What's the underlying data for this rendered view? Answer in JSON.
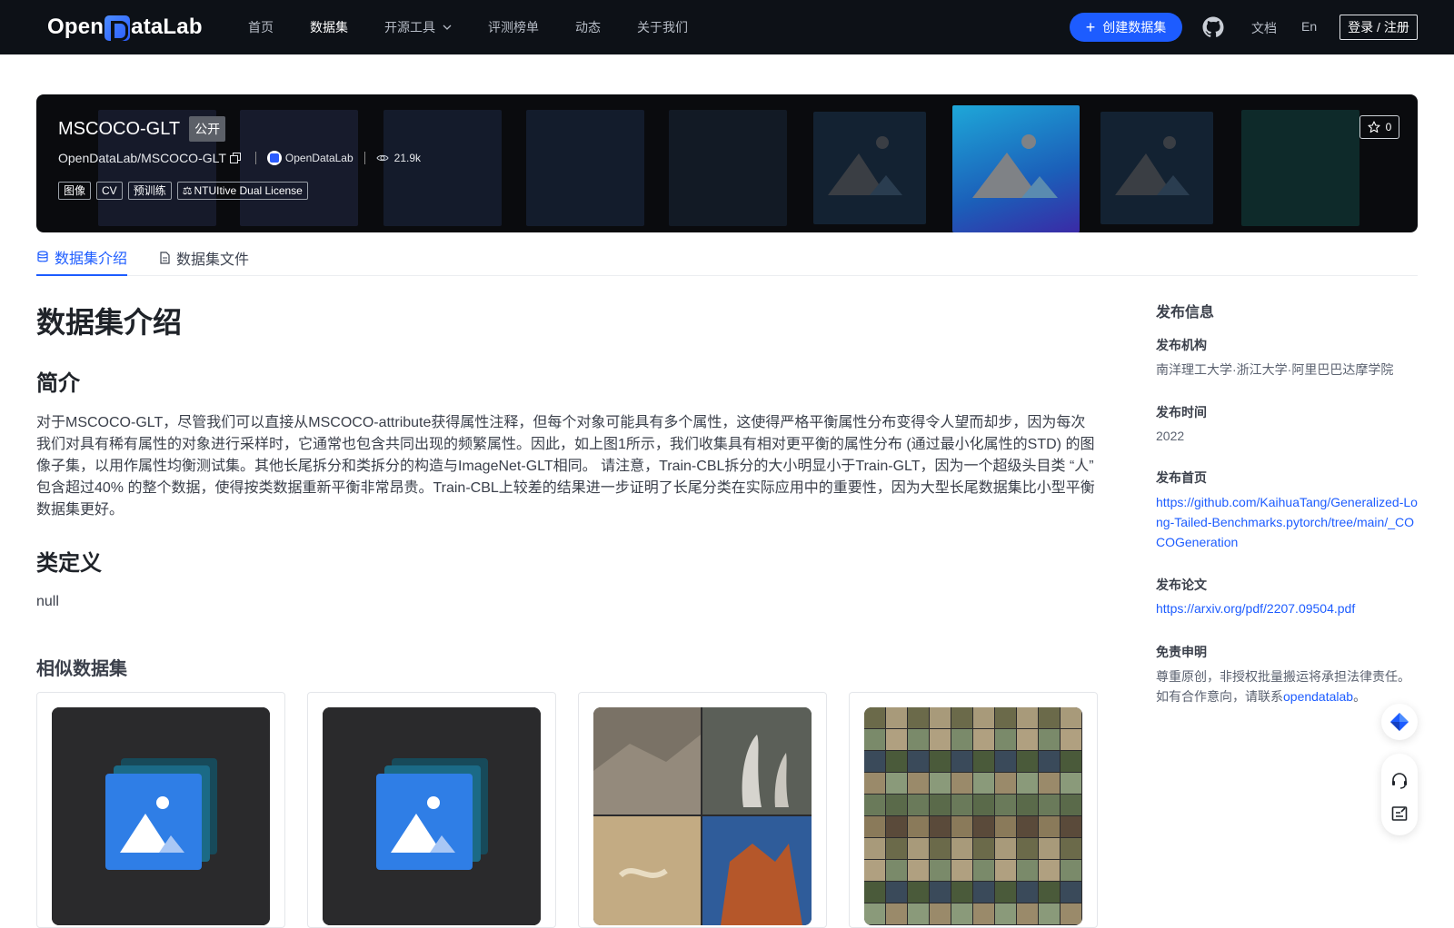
{
  "header": {
    "logo_text": "OpenDataLab",
    "nav": [
      {
        "label": "首页",
        "active": false
      },
      {
        "label": "数据集",
        "active": true
      },
      {
        "label": "开源工具",
        "active": false,
        "dropdown": true
      },
      {
        "label": "评测榜单",
        "active": false
      },
      {
        "label": "动态",
        "active": false
      },
      {
        "label": "关于我们",
        "active": false
      }
    ],
    "create_button": "创建数据集",
    "docs": "文档",
    "lang": "En",
    "login": "登录 / 注册"
  },
  "banner": {
    "title": "MSCOCO-GLT",
    "visibility_badge": "公开",
    "repo_path": "OpenDataLab/MSCOCO-GLT",
    "org": "OpenDataLab",
    "views": "21.9k",
    "tags": [
      "图像",
      "CV",
      "预训练"
    ],
    "license": "NTUItive Dual License",
    "stars": "0"
  },
  "tabs": [
    {
      "label": "数据集介绍",
      "active": true
    },
    {
      "label": "数据集文件",
      "active": false
    }
  ],
  "main": {
    "title": "数据集介绍",
    "summary_heading": "简介",
    "summary_text": "对于MSCOCO-GLT，尽管我们可以直接从MSCOCO-attribute获得属性注释，但每个对象可能具有多个属性，这使得严格平衡属性分布变得令人望而却步，因为每次我们对具有稀有属性的对象进行采样时，它通常也包含共同出现的频繁属性。因此，如上图1所示，我们收集具有相对更平衡的属性分布 (通过最小化属性的STD) 的图像子集，以用作属性均衡测试集。其他长尾拆分和类拆分的构造与ImageNet-GLT相同。 请注意，Train-CBL拆分的大小明显小于Train-GLT，因为一个超级头目类 “人” 包含超过40% 的整个数据，使得按类数据重新平衡非常昂贵。Train-CBL上较差的结果进一步证明了长尾分类在实际应用中的重要性，因为大型长尾数据集比小型平衡数据集更好。",
    "classdef_heading": "类定义",
    "classdef_text": "null",
    "similar_heading": "相似数据集"
  },
  "sidebar": {
    "heading": "发布信息",
    "org_label": "发布机构",
    "org_value": "南洋理工大学·浙江大学·阿里巴巴达摩学院",
    "time_label": "发布时间",
    "time_value": "2022",
    "home_label": "发布首页",
    "home_value": "https://github.com/KaihuaTang/Generalized-Long-Tailed-Benchmarks.pytorch/tree/main/_COCOGeneration",
    "paper_label": "发布论文",
    "paper_value": "https://arxiv.org/pdf/2207.09504.pdf",
    "disclaimer_label": "免责申明",
    "disclaimer_line1": "尊重原创，非授权批量搬运将承担法律责任。",
    "disclaimer_line2_prefix": "如有合作意向，请联系",
    "disclaimer_link": "opendatalab",
    "disclaimer_line2_suffix": "。"
  },
  "colors": {
    "nav_bg": "#0d1117",
    "accent": "#1d5cff",
    "banner_bg": "#0a0b0e"
  }
}
